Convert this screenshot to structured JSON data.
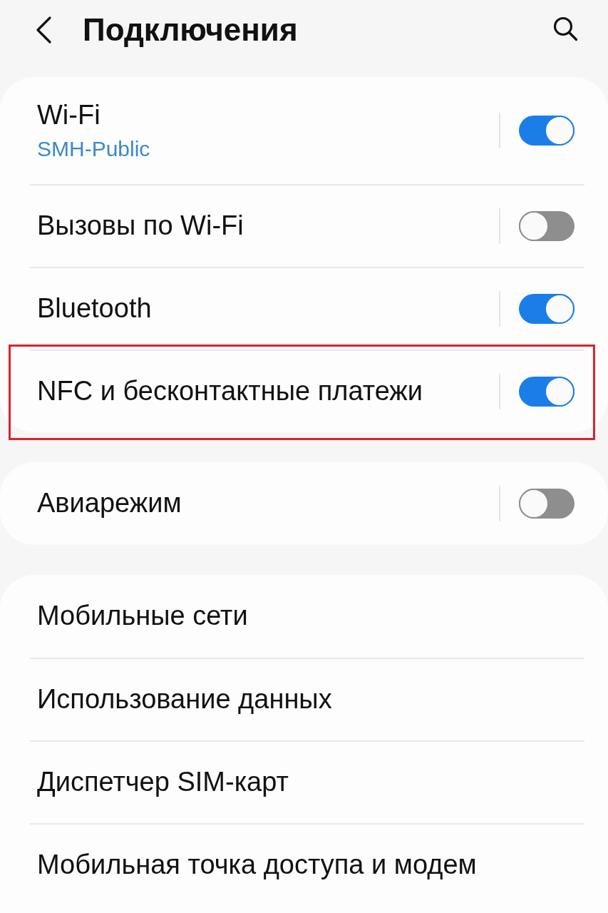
{
  "header": {
    "title": "Подключения"
  },
  "groups": [
    {
      "items": [
        {
          "kind": "toggle",
          "title": "Wi-Fi",
          "subtitle": "SMH-Public",
          "on": true,
          "highlighted": false
        },
        {
          "kind": "toggle",
          "title": "Вызовы по Wi-Fi",
          "on": false,
          "highlighted": false
        },
        {
          "kind": "toggle",
          "title": "Bluetooth",
          "on": true,
          "highlighted": false
        },
        {
          "kind": "toggle",
          "title": "NFC и бесконтактные платежи",
          "on": true,
          "highlighted": true
        }
      ]
    },
    {
      "items": [
        {
          "kind": "toggle",
          "title": "Авиарежим",
          "on": false,
          "highlighted": false
        }
      ]
    },
    {
      "items": [
        {
          "kind": "link",
          "title": "Мобильные сети",
          "highlighted": false
        },
        {
          "kind": "link",
          "title": "Использование данных",
          "highlighted": false
        },
        {
          "kind": "link",
          "title": "Диспетчер SIM-карт",
          "highlighted": false
        },
        {
          "kind": "link",
          "title": "Мобильная точка доступа и модем",
          "highlighted": false
        }
      ]
    }
  ]
}
